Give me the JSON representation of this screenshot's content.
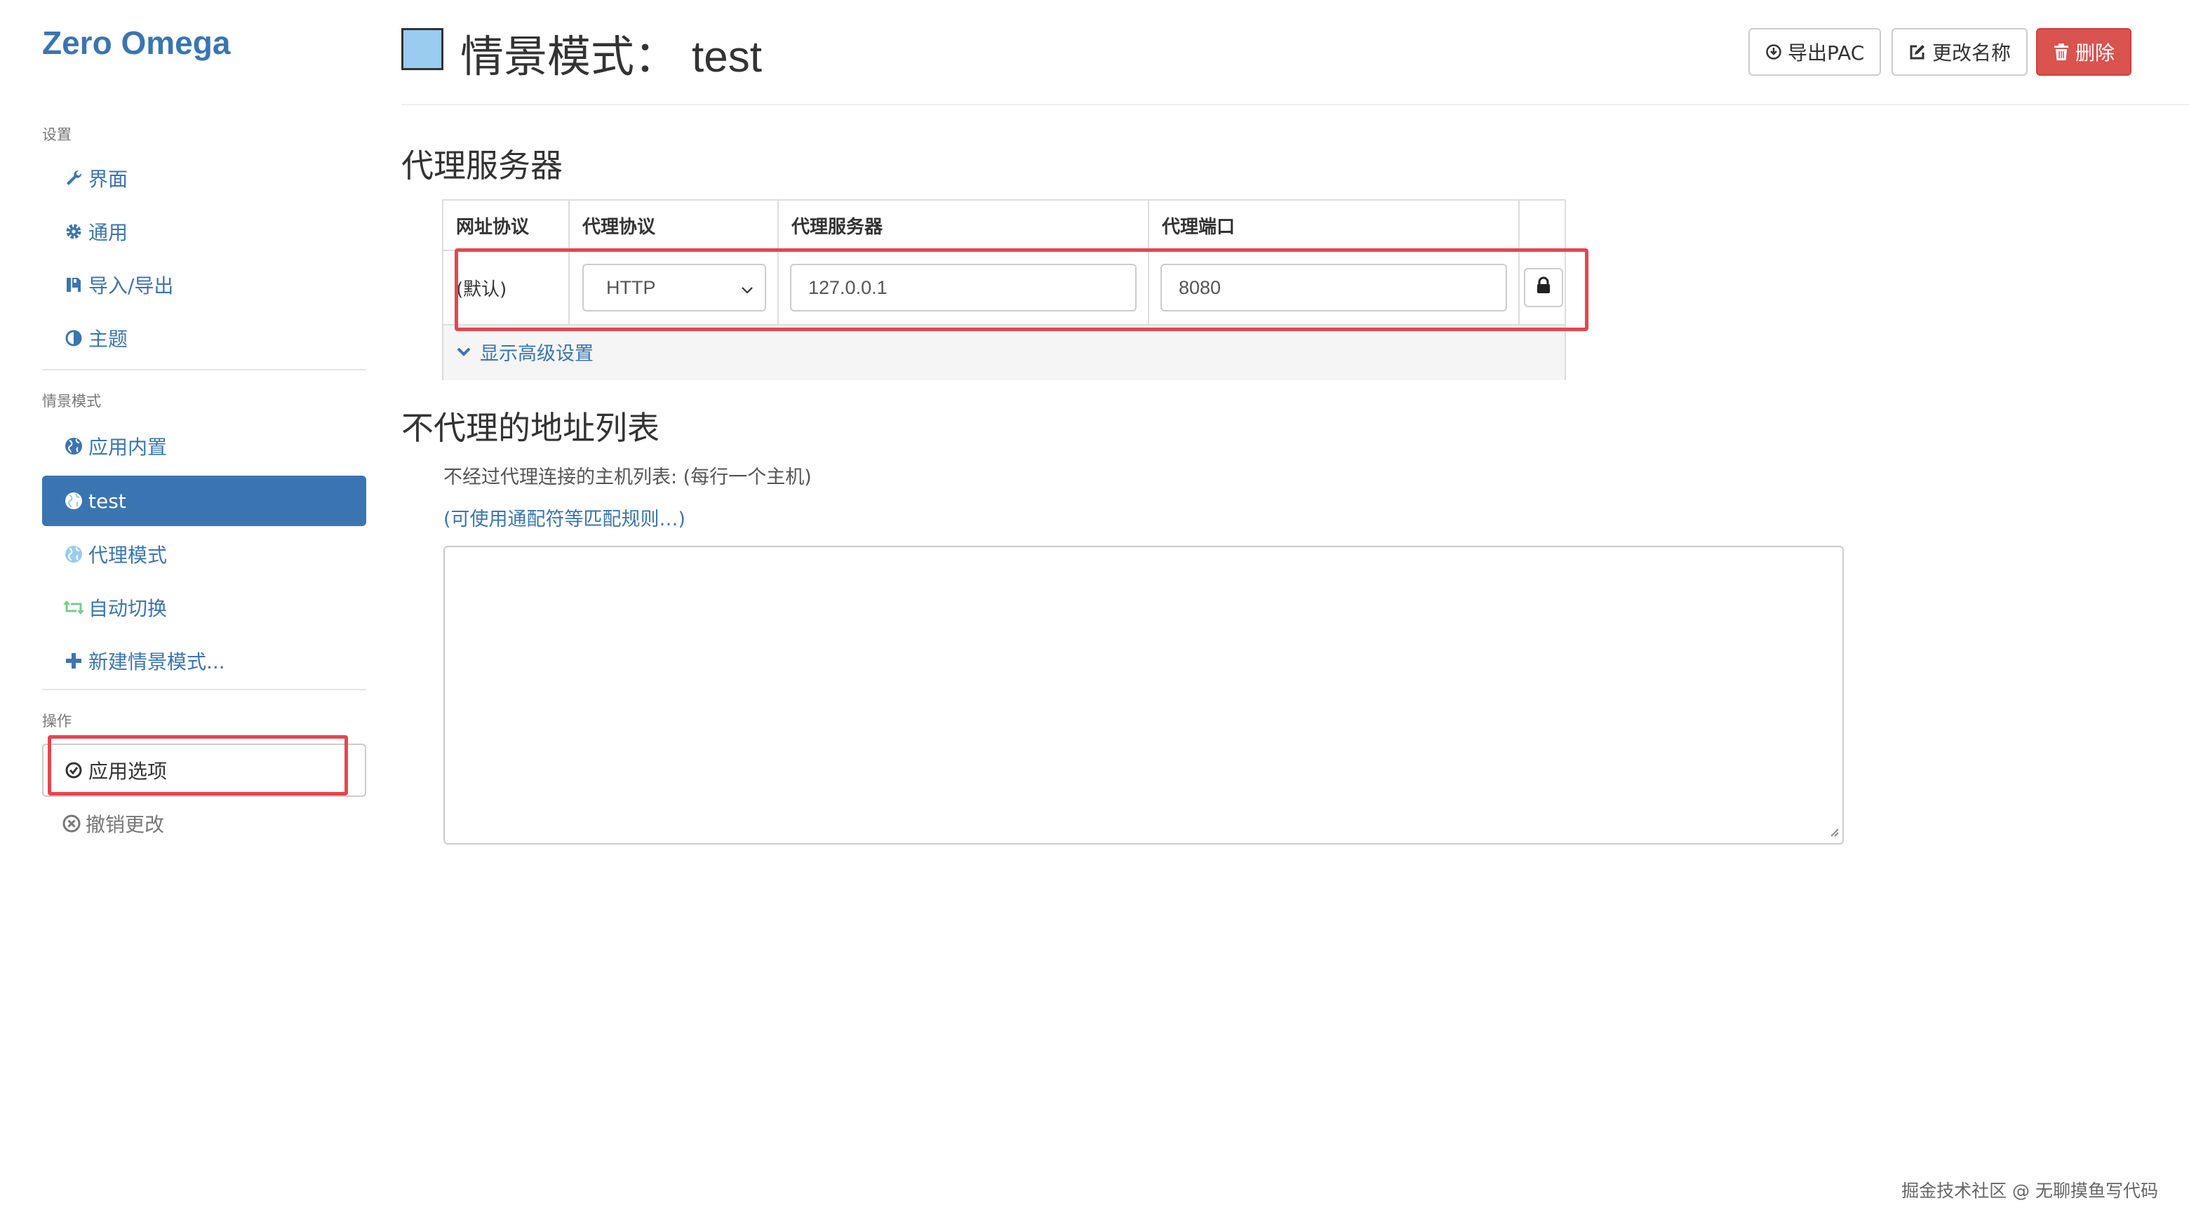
{
  "sidebar": {
    "brand": "Zero Omega",
    "settings_header": "设置",
    "settings_items": [
      {
        "label": "界面",
        "icon": "wrench-icon"
      },
      {
        "label": "通用",
        "icon": "gear-icon"
      },
      {
        "label": "导入/导出",
        "icon": "import-export-icon"
      },
      {
        "label": "主题",
        "icon": "contrast-icon"
      }
    ],
    "profiles_header": "情景模式",
    "profile_items": [
      {
        "label": "应用内置",
        "icon": "globe-icon"
      },
      {
        "label": "test",
        "icon": "globe-icon",
        "active": true
      },
      {
        "label": "代理模式",
        "icon": "globe-icon"
      },
      {
        "label": "自动切换",
        "icon": "retweet-icon"
      },
      {
        "label": "新建情景模式...",
        "icon": "plus-icon"
      }
    ],
    "actions_header": "操作",
    "apply_label": "应用选项",
    "discard_label": "撤销更改"
  },
  "header": {
    "title_prefix": "情景模式：",
    "profile_name": "test",
    "swatch_color": "#99ccee",
    "export_pac_label": "导出PAC",
    "rename_label": "更改名称",
    "delete_label": "删除"
  },
  "proxy_section": {
    "title": "代理服务器",
    "columns": [
      "网址协议",
      "代理协议",
      "代理服务器",
      "代理端口"
    ],
    "row": {
      "scheme": "(默认)",
      "protocol": "HTTP",
      "server": "127.0.0.1",
      "port": "8080"
    },
    "advanced_label": "显示高级设置"
  },
  "bypass_section": {
    "title": "不代理的地址列表",
    "help_text": "不经过代理连接的主机列表: (每行一个主机)",
    "wildcard_link": "(可使用通配符等匹配规则…)",
    "textarea_value": ""
  },
  "watermark": "掘金技术社区 @ 无聊摸鱼写代码",
  "colors": {
    "accent": "#3a75b2",
    "danger": "#d9534f",
    "highlight": "#e5464f"
  }
}
